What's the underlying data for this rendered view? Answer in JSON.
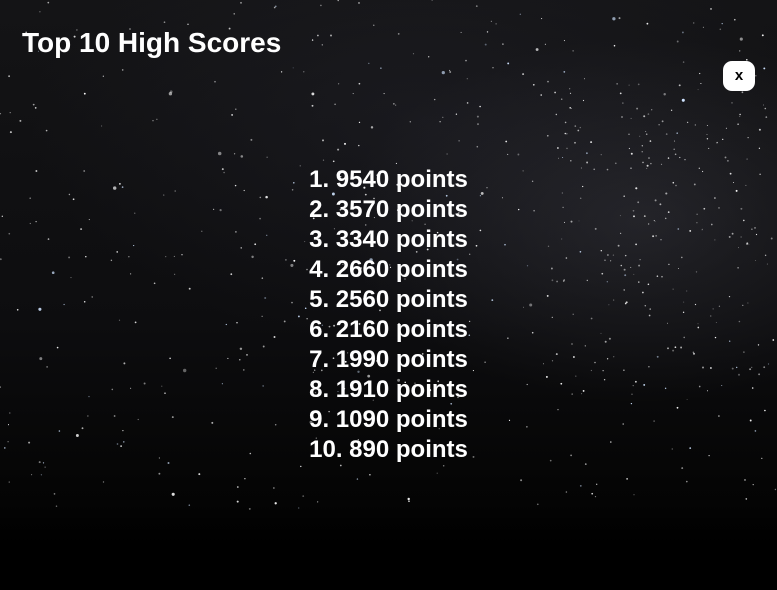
{
  "screen": {
    "title": "Top 10 High Scores",
    "close_label": "x"
  },
  "scores": [
    {
      "text": "1. 9540 points",
      "rank": 1,
      "points": 9540
    },
    {
      "text": "2. 3570 points",
      "rank": 2,
      "points": 3570
    },
    {
      "text": "3. 3340 points",
      "rank": 3,
      "points": 3340
    },
    {
      "text": "4. 2660 points",
      "rank": 4,
      "points": 2660
    },
    {
      "text": "5. 2560 points",
      "rank": 5,
      "points": 2560
    },
    {
      "text": "6. 2160 points",
      "rank": 6,
      "points": 2160
    },
    {
      "text": "7. 1990 points",
      "rank": 7,
      "points": 1990
    },
    {
      "text": "8. 1910 points",
      "rank": 8,
      "points": 1910
    },
    {
      "text": "9. 1090 points",
      "rank": 9,
      "points": 1090
    },
    {
      "text": "10. 890 points",
      "rank": 10,
      "points": 890
    }
  ],
  "colors": {
    "text": "#ffffff",
    "button_background": "#ffffff",
    "button_text": "#000000",
    "background": "#0d0d0f"
  }
}
